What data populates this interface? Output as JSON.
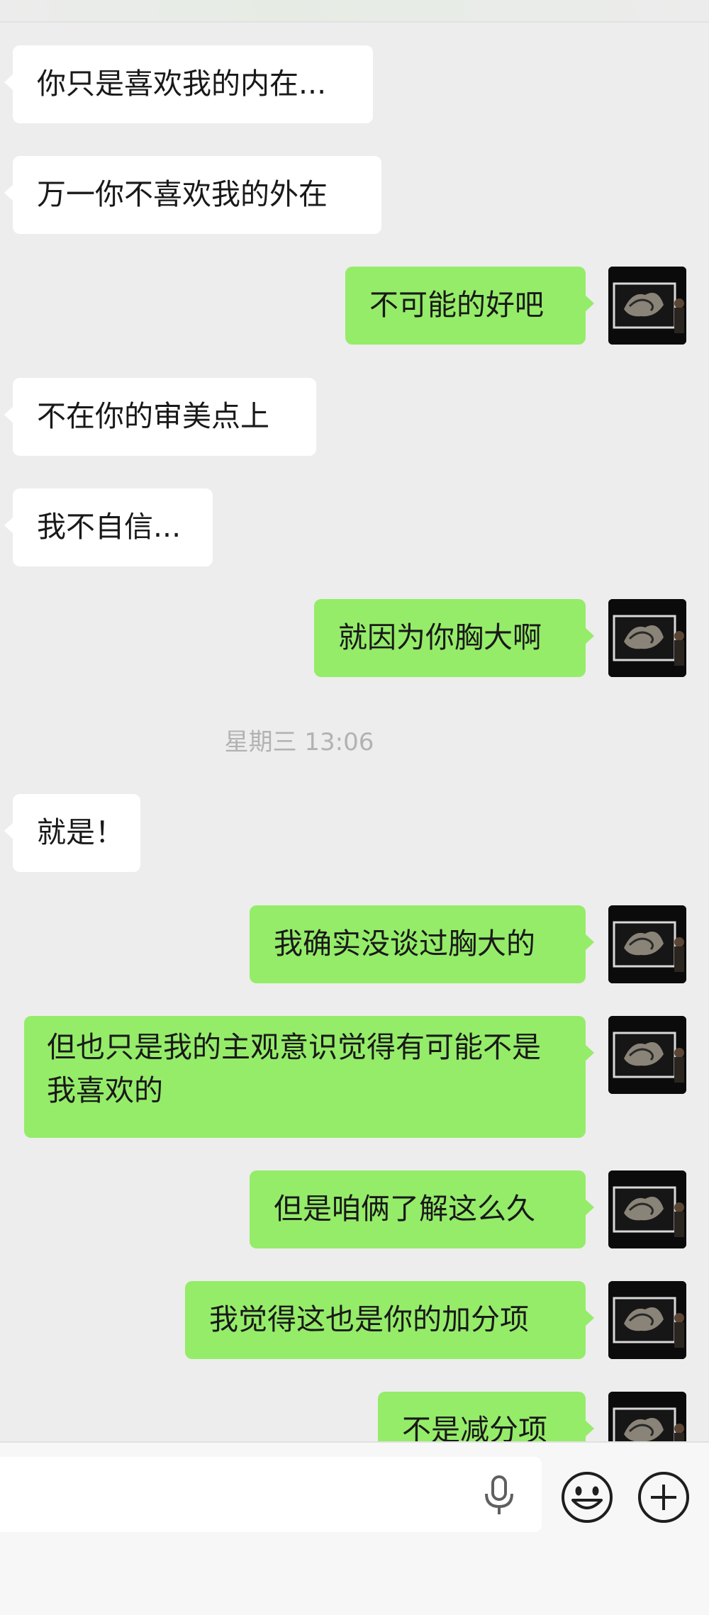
{
  "messages": [
    {
      "side": "left",
      "text": "你只是喜欢我的内在..."
    },
    {
      "side": "left",
      "text": "万一你不喜欢我的外在"
    },
    {
      "side": "right",
      "text": "不可能的好吧"
    },
    {
      "side": "left",
      "text": "不在你的审美点上"
    },
    {
      "side": "left",
      "text": "我不自信..."
    },
    {
      "side": "right",
      "text": "就因为你胸大啊"
    },
    {
      "side": "left",
      "text": "就是！"
    },
    {
      "side": "right",
      "text": "我确实没谈过胸大的"
    },
    {
      "side": "right",
      "text": "但也只是我的主观意识觉得有可能不是我喜欢的"
    },
    {
      "side": "right",
      "text": "但是咱俩了解这么久"
    },
    {
      "side": "right",
      "text": "我觉得这也是你的加分项"
    },
    {
      "side": "right",
      "text": "不是减分项"
    }
  ],
  "timestamp": "星期三 13:06",
  "input_bar": {
    "mic_icon": "microphone-icon",
    "emoji_icon": "smiley-face-icon",
    "plus_icon": "plus-circle-icon"
  },
  "colors": {
    "background": "#ededed",
    "my_bubble": "#95ec69",
    "their_bubble": "#ffffff",
    "timestamp_text": "#b2b2b2"
  }
}
